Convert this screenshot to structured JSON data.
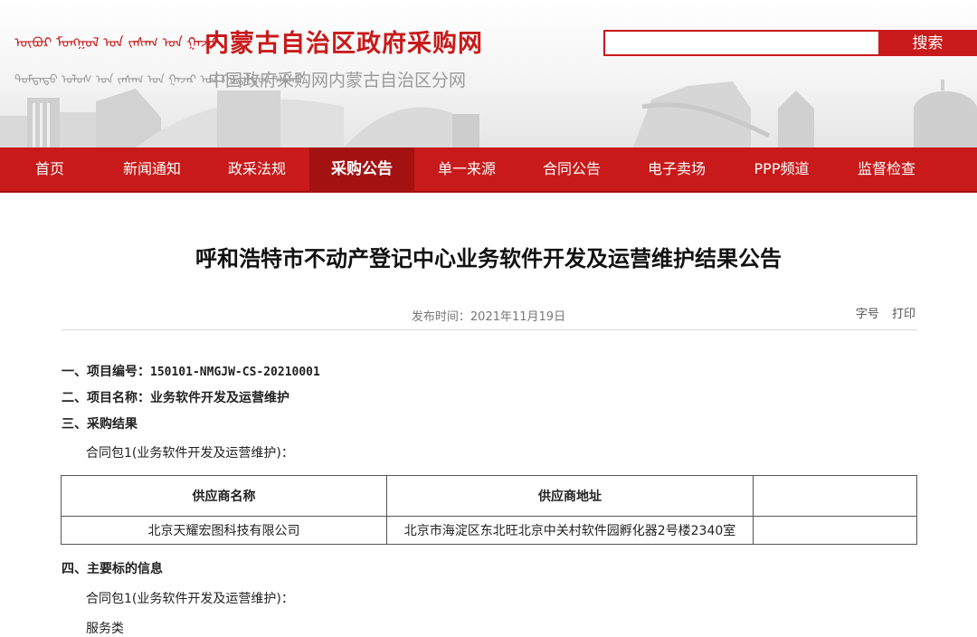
{
  "header": {
    "mongolian_title": "ᠥᠪᠦᠷ ᠮᠣᠩᠭᠣᠯ ᠤᠨ ᠵᠠᠰᠠᠭ ᠤᠨ ᠭᠠᠵᠠᠷ",
    "mongolian_subtitle": "ᠳᠤᠮᠳᠠᠳᠤ ᠤᠯᠤᠰ ᠤᠨ ᠵᠠᠰᠠᠭ ᠤᠨ ᠭᠠᠵᠠᠷ ᠤᠨ ᠬᠤᠳᠠᠯᠳᠤᠨ ᠠᠪᠬᠤ",
    "site_title": "内蒙古自治区政府采购网",
    "site_subtitle": "中国政府采购网内蒙古自治区分网",
    "search_placeholder": "",
    "search_button": "搜索"
  },
  "nav": {
    "items": [
      "首页",
      "新闻通知",
      "政采法规",
      "采购公告",
      "单一来源",
      "合同公告",
      "电子卖场",
      "PPP频道",
      "监督检查"
    ],
    "active": "采购公告"
  },
  "article": {
    "title": "呼和浩特市不动产登记中心业务软件开发及运营维护结果公告",
    "publish_time": "发布时间：2021年11月19日",
    "tools": {
      "font_size": "字号",
      "print": "打印"
    },
    "s1_label": "一、项目编号：",
    "s1_value": "150101-NMGJW-CS-20210001",
    "s2": "二、项目名称：业务软件开发及运营维护",
    "s3": "三、采购结果",
    "package_1": "合同包1(业务软件开发及运营维护)：",
    "table": {
      "headers": [
        "供应商名称",
        "供应商地址",
        ""
      ],
      "rows": [
        [
          "北京天耀宏图科技有限公司",
          "北京市海淀区东北旺北京中关村软件园孵化器2号楼2340室",
          ""
        ]
      ]
    },
    "s4": "四、主要标的信息",
    "package_1b": "合同包1(业务软件开发及运营维护)：",
    "service_type": "服务类"
  },
  "colors": {
    "brand_red": "#c81a1a",
    "active_nav": "#a31111"
  }
}
